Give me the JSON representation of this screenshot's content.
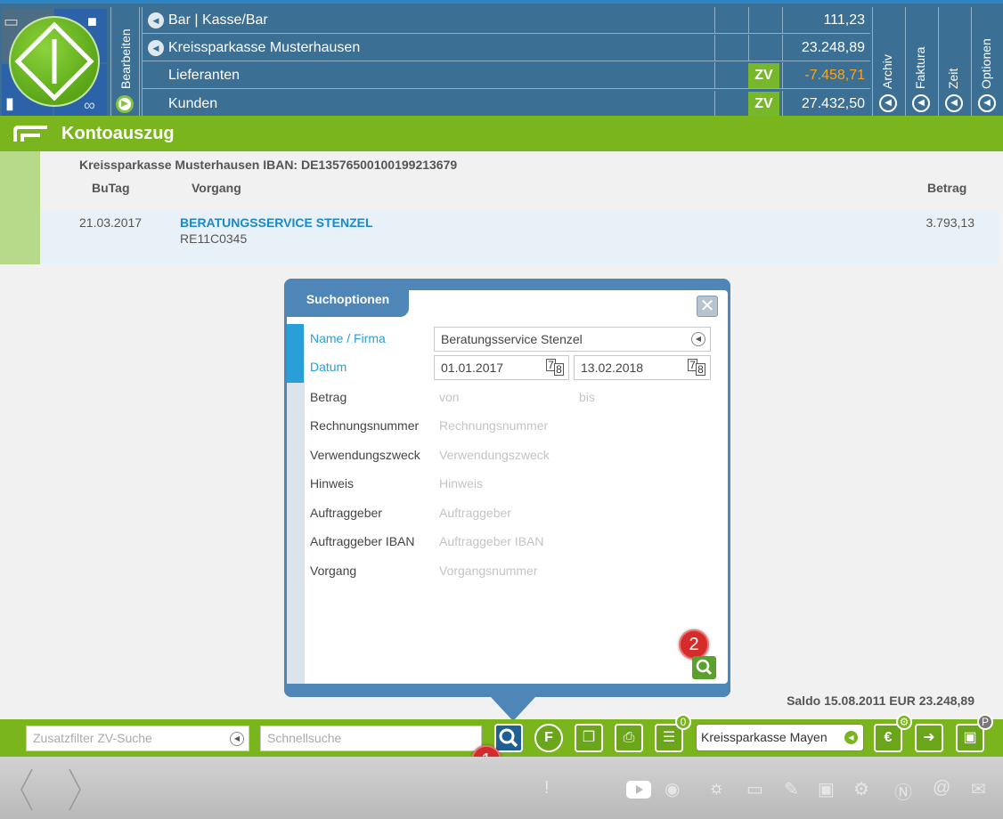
{
  "header": {
    "bearbeiten_label": "Bearbeiten",
    "accounts": [
      {
        "name": "Bar | Kasse/Bar",
        "value": "111,23",
        "zv": "",
        "has_arrow": true
      },
      {
        "name": "Kreissparkasse Musterhausen",
        "value": "23.248,89",
        "zv": "",
        "has_arrow": true
      },
      {
        "name": "Lieferanten",
        "value": "-7.458,71",
        "zv": "ZV",
        "has_arrow": false
      },
      {
        "name": "Kunden",
        "value": "27.432,50",
        "zv": "ZV",
        "has_arrow": false
      }
    ],
    "side_tabs": [
      {
        "label": "Archiv"
      },
      {
        "label": "Faktura"
      },
      {
        "label": "Zeit"
      },
      {
        "label": "Optionen"
      }
    ]
  },
  "page": {
    "title": "Kontoauszug",
    "bank_line": "Kreissparkasse Musterhausen IBAN: DE13576500100199213679",
    "columns": {
      "butag": "BuTag",
      "vorgang": "Vorgang",
      "betrag": "Betrag"
    },
    "rows": [
      {
        "date": "21.03.2017",
        "name": "BERATUNGSSERVICE STENZEL",
        "ref": "RE11C0345",
        "amount": "3.793,13"
      }
    ],
    "saldo": "Saldo 15.08.2011 EUR 23.248,89"
  },
  "dialog": {
    "title": "Suchoptionen",
    "close_glyph": "✕",
    "fields": {
      "name_label": "Name / Firma",
      "name_value": "Beratungsservice Stenzel",
      "datum_label": "Datum",
      "date_from": "01.01.2017",
      "date_to": "13.02.2018",
      "cal_a": "7",
      "cal_b": "8",
      "betrag_label": "Betrag",
      "betrag_from_ph": "von",
      "betrag_to_ph": "bis",
      "rechnung_label": "Rechnungsnummer",
      "rechnung_ph": "Rechnungsnummer",
      "verwendung_label": "Verwendungszweck",
      "verwendung_ph": "Verwendungszweck",
      "hinweis_label": "Hinweis",
      "hinweis_ph": "Hinweis",
      "auftraggeber_label": "Auftraggeber",
      "auftraggeber_ph": "Auftraggeber",
      "auftraggeber_iban_label": "Auftraggeber IBAN",
      "auftraggeber_iban_ph": "Auftraggeber IBAN",
      "vorgang_label": "Vorgang",
      "vorgang_ph": "Vorgangsnummer"
    },
    "badge_2": "2"
  },
  "toolbar": {
    "zusatzfilter_ph": "Zusatzfilter ZV-Suche",
    "schnellsuche_ph": "Schnellsuche",
    "badge_1": "1",
    "badge_count": "0",
    "f_label": "F",
    "bank_select": "Kreissparkasse Mayen",
    "euro_label": "€",
    "p_badge": "P"
  },
  "colors": {
    "header_blue": "#3b6f93",
    "accent_green": "#7ab51d",
    "link_blue": "#1a88c9",
    "negative_orange": "#f5a623",
    "badge_red": "#d42b2b"
  }
}
